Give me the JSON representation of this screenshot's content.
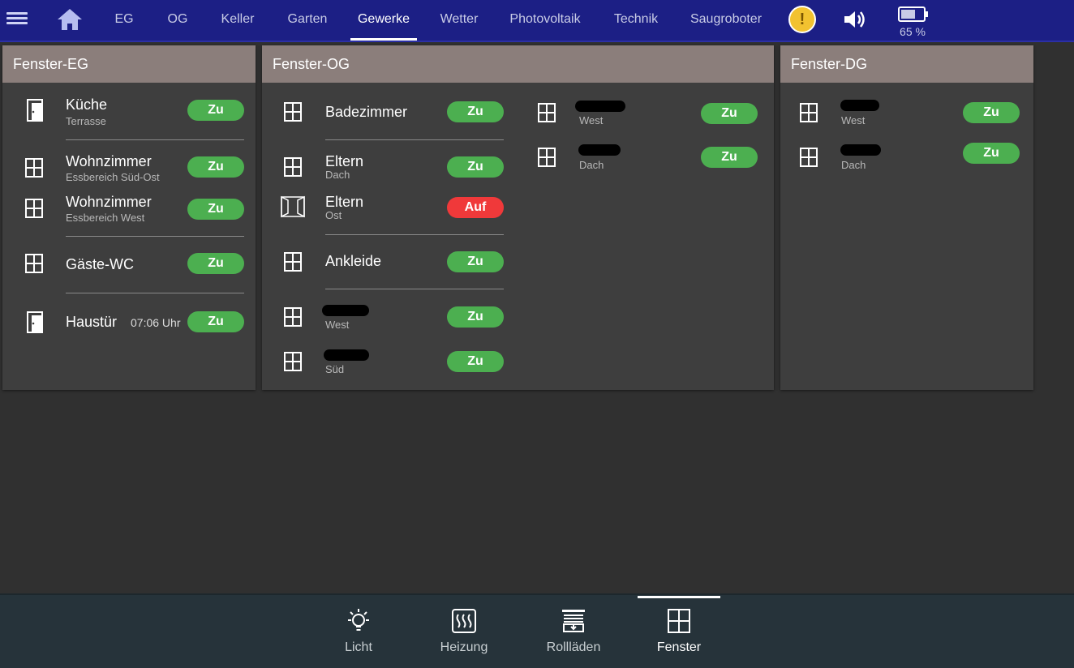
{
  "nav": {
    "items": [
      "EG",
      "OG",
      "Keller",
      "Garten",
      "Gewerke",
      "Wetter",
      "Photovoltaik",
      "Technik",
      "Saugroboter"
    ],
    "active": "Gewerke",
    "alert_icon": "!",
    "battery_text": "65 %"
  },
  "status_colors": {
    "closed": "#4caf50",
    "open": "#f0393a",
    "header": "#8b7e7b",
    "nav": "#1c1f85"
  },
  "panels": {
    "eg": {
      "title": "Fenster-EG",
      "rows": [
        {
          "title": "Küche",
          "sub": "Terrasse",
          "state": "Zu",
          "icon": "door-icon"
        },
        {
          "title": "Wohnzimmer",
          "sub": "Essbereich Süd-Ost",
          "state": "Zu",
          "icon": "window-icon"
        },
        {
          "title": "Wohnzimmer",
          "sub": "Essbereich West",
          "state": "Zu",
          "icon": "window-icon"
        },
        {
          "title": "Gäste-WC",
          "sub": "",
          "state": "Zu",
          "icon": "window-icon"
        },
        {
          "title": "Haustür",
          "time": "07:06 Uhr",
          "state": "Zu",
          "icon": "door-icon"
        }
      ]
    },
    "og": {
      "title": "Fenster-OG",
      "rows": [
        {
          "title": "Badezimmer",
          "state": "Zu",
          "icon": "window-icon"
        },
        {
          "title": "Eltern",
          "sub": "Dach",
          "state": "Zu",
          "icon": "window-icon"
        },
        {
          "title": "Eltern",
          "sub": "Ost",
          "state": "Auf",
          "icon": "window-open-icon"
        },
        {
          "title": "Ankleide",
          "state": "Zu",
          "icon": "window-icon"
        },
        {
          "sub": "West",
          "state": "Zu",
          "icon": "window-icon"
        },
        {
          "sub": "Süd",
          "state": "Zu",
          "icon": "window-icon"
        },
        {
          "sub": "West",
          "state": "Zu",
          "icon": "window-icon"
        },
        {
          "sub": "Dach",
          "state": "Zu",
          "icon": "window-icon"
        }
      ]
    },
    "dg": {
      "title": "Fenster-DG",
      "rows": [
        {
          "sub": "West",
          "state": "Zu",
          "icon": "window-icon"
        },
        {
          "sub": "Dach",
          "state": "Zu",
          "icon": "window-icon"
        }
      ]
    }
  },
  "bottom_tabs": [
    {
      "label": "Licht",
      "icon": "lightbulb-icon"
    },
    {
      "label": "Heizung",
      "icon": "heating-icon"
    },
    {
      "label": "Rollläden",
      "icon": "shutter-icon"
    },
    {
      "label": "Fenster",
      "icon": "window-icon"
    }
  ],
  "bottom_active": "Fenster"
}
